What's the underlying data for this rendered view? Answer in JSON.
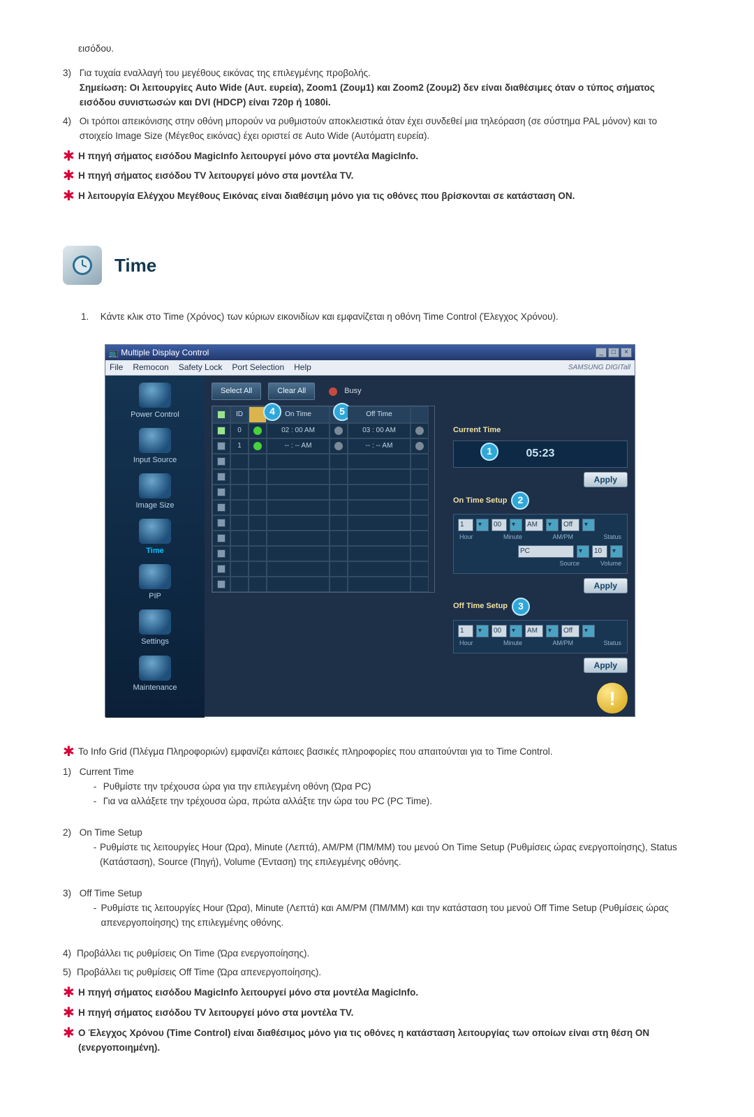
{
  "upper": {
    "intro": "εισόδου.",
    "item3": "Για τυχαία εναλλαγή του μεγέθους εικόνας της επιλεγμένης προβολής.",
    "item3note": "Σημείωση: Οι λειτουργίες Auto Wide (Αυτ. ευρεία), Zoom1 (Ζουμ1) και Zoom2 (Ζουμ2) δεν είναι διαθέσιμες όταν ο τύπος σήματος εισόδου συνιστωσών και DVI (HDCP) είναι 720p ή 1080i.",
    "item4": "Οι τρόποι απεικόνισης στην οθόνη μπορούν να ρυθμιστούν αποκλειστικά όταν έχει συνδεθεί μια τηλεόραση (σε σύστημα PAL μόνον) και το στοιχείο Image Size (Μέγεθος εικόνας) έχει οριστεί σε Auto Wide (Αυτόματη ευρεία).",
    "star1": "Η πηγή σήματος εισόδου MagicInfo λειτουργεί μόνο στα μοντέλα MagicInfo.",
    "star2": "Η πηγή σήματος εισόδου TV λειτουργεί μόνο στα μοντέλα TV.",
    "star3": "Η λειτουργία Ελέγχου Μεγέθους Εικόνας είναι διαθέσιμη μόνο για τις οθόνες που βρίσκονται σε κατάσταση ON."
  },
  "section": {
    "title": "Time",
    "lead_num": "1.",
    "lead_txt": "Κάντε κλικ στο Time (Χρόνος) των κύριων εικονιδίων και εμφανίζεται η οθόνη Time Control (Έλεγχος Χρόνου)."
  },
  "app": {
    "titlebar": "Multiple Display Control",
    "menus": [
      "File",
      "Remocon",
      "Safety Lock",
      "Port Selection",
      "Help"
    ],
    "brand": "SAMSUNG DIGITall",
    "sidebar": [
      {
        "label": "Power Control"
      },
      {
        "label": "Input Source"
      },
      {
        "label": "Image Size"
      },
      {
        "label": "Time",
        "active": true
      },
      {
        "label": "PIP"
      },
      {
        "label": "Settings"
      },
      {
        "label": "Maintenance"
      }
    ],
    "select_all": "Select All",
    "clear_all": "Clear All",
    "busy": "Busy",
    "grid": {
      "headers": {
        "id": "ID",
        "on": "On Time",
        "off": "Off Time"
      },
      "rows": [
        {
          "checked": true,
          "id": "0",
          "dot": "green",
          "on": "02 : 00 AM",
          "odot": "gray",
          "off": "03 : 00 AM",
          "odot2": "gray"
        },
        {
          "checked": false,
          "id": "1",
          "dot": "green",
          "on": "-- : -- AM",
          "odot": "gray",
          "off": "-- : -- AM",
          "odot2": "gray"
        }
      ]
    },
    "right": {
      "current_label": "Current Time",
      "clock": "05:23",
      "apply": "Apply",
      "on_setup": "On Time Setup",
      "off_setup": "Off Time Setup",
      "hour_val": "1",
      "min_val": "00",
      "ampm_val": "AM",
      "status_val": "Off",
      "pc_val": "PC",
      "vol_val": "10",
      "labels": {
        "hour": "Hour",
        "minute": "Minute",
        "ampm": "AM/PM",
        "status": "Status",
        "source": "Source",
        "volume": "Volume"
      }
    }
  },
  "lower": {
    "star_info": "Το Info Grid (Πλέγμα Πληροφοριών) εμφανίζει κάποιες βασικές πληροφορίες που απαιτούνται για το Time Control.",
    "i1": {
      "t": "Current Time",
      "b1": "Ρυθμίστε την τρέχουσα ώρα για την επιλεγμένη οθόνη (Ώρα PC)",
      "b2": "Για να αλλάξετε την τρέχουσα ώρα, πρώτα αλλάξτε την ώρα του PC (PC Time)."
    },
    "i2": {
      "t": "On Time Setup",
      "b": "Ρυθμίστε τις λειτουργίες Hour (Ώρα), Minute (Λεπτά), AM/PM (ΠΜ/ΜΜ) του μενού On Time Setup (Ρυθμίσεις ώρας ενεργοποίησης), Status (Κατάσταση), Source (Πηγή), Volume (Ένταση) της επιλεγμένης οθόνης."
    },
    "i3": {
      "t": "Off Time Setup",
      "b": "Ρυθμίστε τις λειτουργίες Hour (Ώρα), Minute (Λεπτά) και AM/PM (ΠΜ/ΜΜ) και την κατάσταση του μενού Off Time Setup (Ρυθμίσεις ώρας απενεργοποίησης) της επιλεγμένης οθόνης."
    },
    "i4": "Προβάλλει τις ρυθμίσεις On Time (Ώρα ενεργοποίησης).",
    "i5": "Προβάλλει τις ρυθμίσεις Off Time (Ώρα απενεργοποίησης).",
    "star4": "Η πηγή σήματος εισόδου MagicInfo λειτουργεί μόνο στα μοντέλα MagicInfo.",
    "star5": "Η πηγή σήματος εισόδου TV λειτουργεί μόνο στα μοντέλα TV.",
    "star6": "Ο Έλεγχος Χρόνου (Time Control) είναι διαθέσιμος μόνο για τις οθόνες η κατάσταση λειτουργίας των οποίων είναι στη θέση ON (ενεργοποιημένη)."
  }
}
